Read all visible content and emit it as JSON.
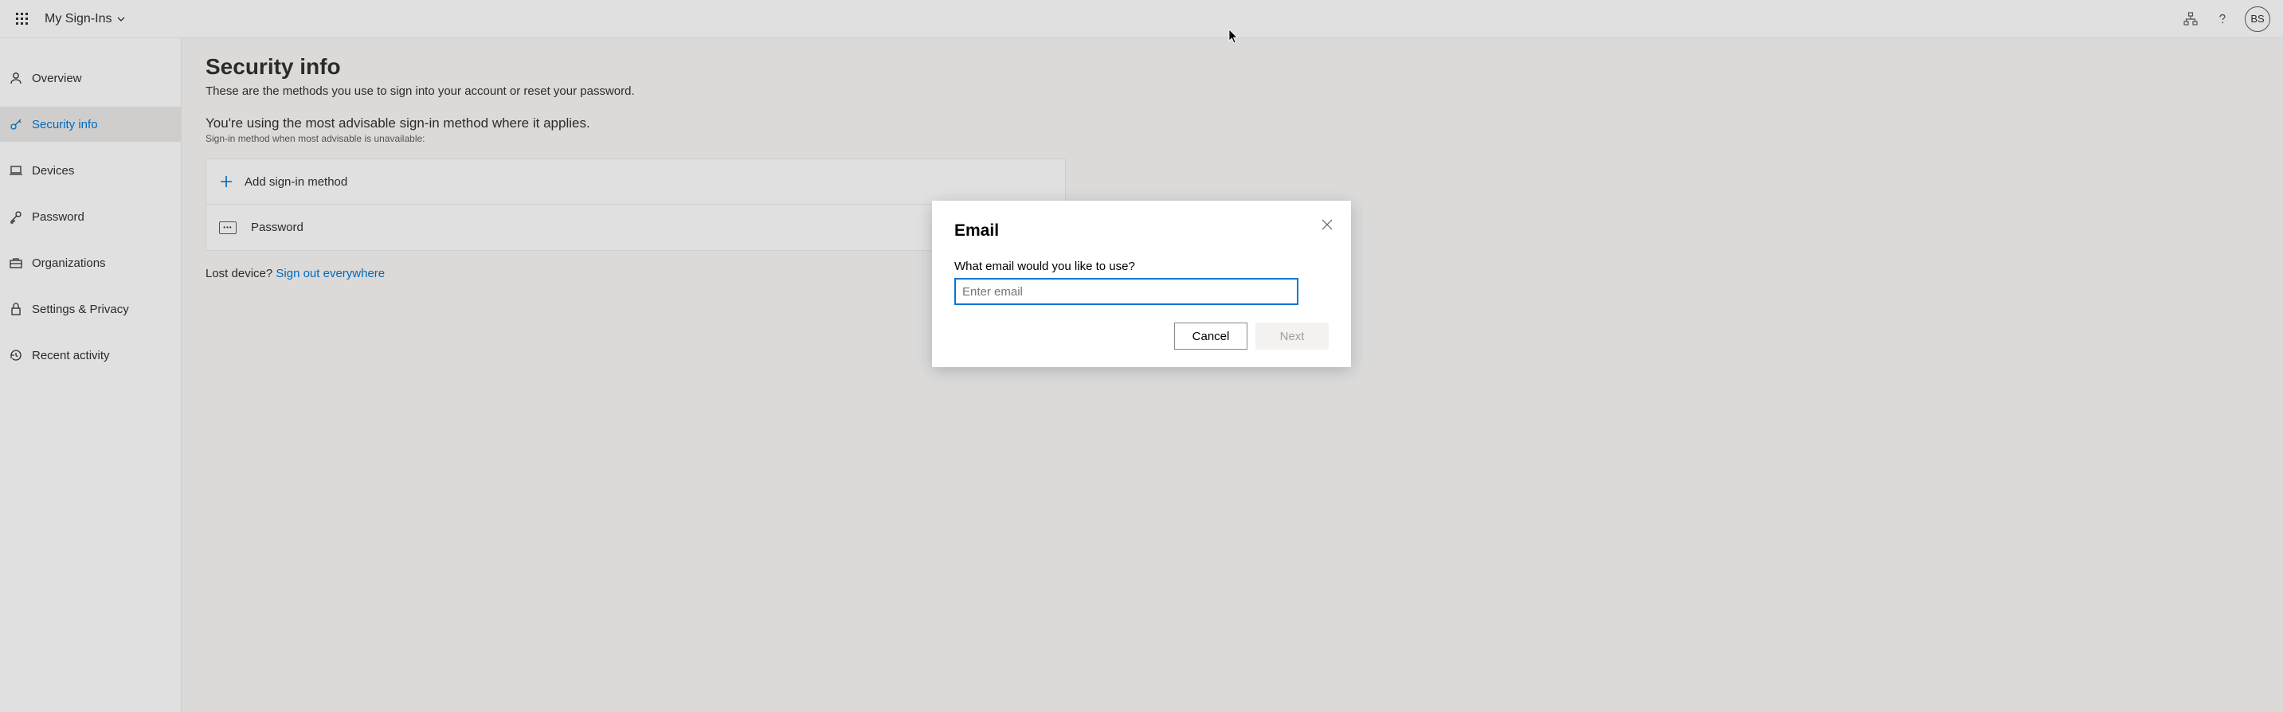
{
  "header": {
    "app_title": "My Sign-Ins",
    "avatar_initials": "BS"
  },
  "sidebar": {
    "items": [
      {
        "label": "Overview"
      },
      {
        "label": "Security info"
      },
      {
        "label": "Devices"
      },
      {
        "label": "Password"
      },
      {
        "label": "Organizations"
      },
      {
        "label": "Settings & Privacy"
      },
      {
        "label": "Recent activity"
      }
    ]
  },
  "page": {
    "title": "Security info",
    "subtitle": "These are the methods you use to sign into your account or reset your password.",
    "advisable": "You're using the most advisable sign-in method where it applies.",
    "advisable_sub": "Sign-in method when most advisable is unavailable:",
    "add_label": "Add sign-in method",
    "password_label": "Password",
    "lost_prefix": "Lost device? ",
    "lost_link": "Sign out everywhere"
  },
  "dialog": {
    "title": "Email",
    "prompt": "What email would you like to use?",
    "placeholder": "Enter email",
    "cancel": "Cancel",
    "next": "Next"
  }
}
